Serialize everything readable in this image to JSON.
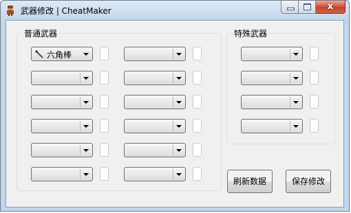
{
  "window": {
    "title": "武器修改 | CheatMaker",
    "close_glyph": "x"
  },
  "normal_weapons": {
    "title": "普通武器",
    "first_selected": "六角棒",
    "first_icon": "staff-icon"
  },
  "special_weapons": {
    "title": "特殊武器"
  },
  "buttons": {
    "refresh": "刷新数据",
    "save": "保存修改"
  },
  "colors": {
    "titlebar": "#c4d6ec",
    "client": "#f0f0f0",
    "close": "#c7452f"
  }
}
